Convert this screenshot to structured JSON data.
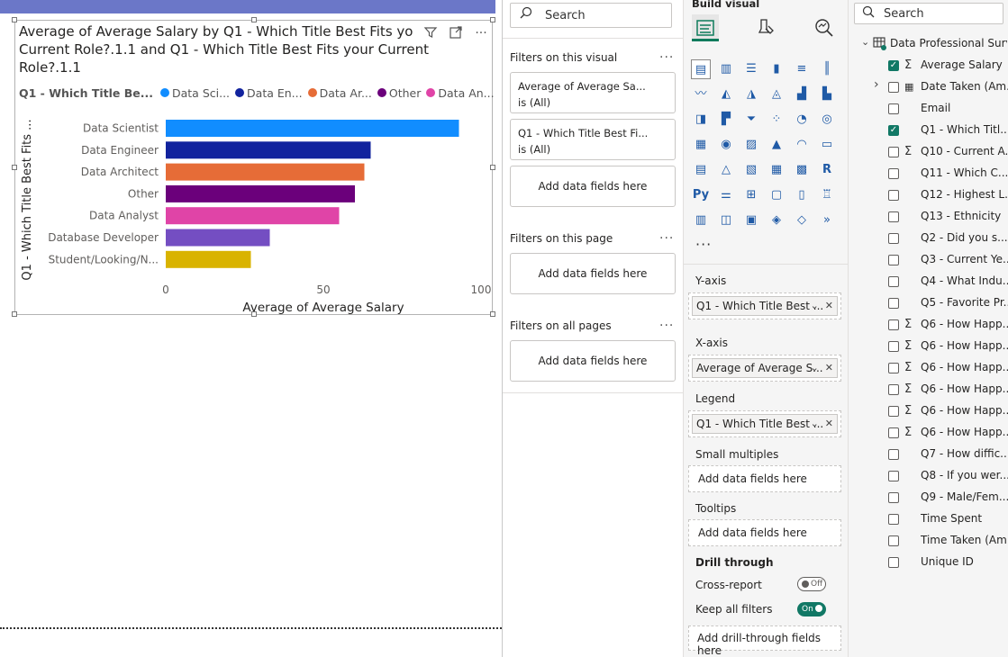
{
  "visual": {
    "title": "Average of Average Salary by Q1 - Which Title Best Fits your Current Role?.1.1 and Q1 - Which Title Best Fits your Current Role?.1.1",
    "title_line1": "Average of Average Salary by Q1 - Which Title Best Fits yo",
    "title_line2": "Current Role?.1.1 and Q1 - Which Title Best Fits your Current",
    "title_line3": "Role?.1.1",
    "legend_title": "Q1 - Which Title Be...",
    "legend_items": [
      {
        "label": "Data Sci...",
        "color": "#118dff"
      },
      {
        "label": "Data En...",
        "color": "#12239e"
      },
      {
        "label": "Data Ar...",
        "color": "#e66c37"
      },
      {
        "label": "Other",
        "color": "#6b007b"
      },
      {
        "label": "Data An...",
        "color": "#e044a7"
      }
    ]
  },
  "chart_data": {
    "type": "bar",
    "orientation": "horizontal",
    "categories": [
      "Data Scientist",
      "Data Engineer",
      "Data Architect",
      "Other",
      "Data Analyst",
      "Database Developer",
      "Student/Looking/N..."
    ],
    "values": [
      93,
      65,
      63,
      60,
      55,
      33,
      27
    ],
    "colors": [
      "#118dff",
      "#12239e",
      "#e66c37",
      "#6b007b",
      "#e044a7",
      "#744ec2",
      "#d9b300"
    ],
    "xlabel": "Average of Average Salary",
    "ylabel": "Q1 - Which Title Best Fits ...",
    "xlim": [
      0,
      100
    ],
    "xticks": [
      "0",
      "50",
      "100"
    ],
    "grid": false,
    "legend_position": "top-left"
  },
  "filters": {
    "search_placeholder": "Search",
    "on_visual_title": "Filters on this visual",
    "card1_line1": "Average of Average Sa...",
    "card1_line2": "is (All)",
    "card2_line1": "Q1 - Which Title Best Fi...",
    "card2_line2": "is (All)",
    "add_fields": "Add data fields here",
    "on_page_title": "Filters on this page",
    "on_all_pages_title": "Filters on all pages",
    "more": "···"
  },
  "build": {
    "title": "Build visual",
    "more": "···",
    "yaxis_label": "Y-axis",
    "yaxis_field": "Q1 - Which Title Best ...",
    "xaxis_label": "X-axis",
    "xaxis_field": "Average of Average S...",
    "legend_label": "Legend",
    "legend_field": "Q1 - Which Title Best ...",
    "small_multiples_label": "Small multiples",
    "tooltips_label": "Tooltips",
    "add_fields": "Add data fields here",
    "drill_through_label": "Drill through",
    "cross_report_label": "Cross-report",
    "cross_report_state": "Off",
    "keep_filters_label": "Keep all filters",
    "keep_filters_state": "On",
    "add_drill_fields": "Add drill-through fields here"
  },
  "data": {
    "search_placeholder": "Search",
    "table_name": "Data Professional Surv...",
    "fields": [
      {
        "label": "Average Salary",
        "checked": true,
        "sigma": true
      },
      {
        "label": "Date Taken (Am...",
        "checked": false,
        "sigma": false,
        "expandable": true
      },
      {
        "label": "Email",
        "checked": false,
        "sigma": false
      },
      {
        "label": "Q1 - Which Titl...",
        "checked": true,
        "sigma": false
      },
      {
        "label": "Q10 - Current A...",
        "checked": false,
        "sigma": true
      },
      {
        "label": "Q11 - Which C...",
        "checked": false,
        "sigma": false
      },
      {
        "label": "Q12 - Highest L...",
        "checked": false,
        "sigma": false
      },
      {
        "label": "Q13 - Ethnicity",
        "checked": false,
        "sigma": false
      },
      {
        "label": "Q2 - Did you s...",
        "checked": false,
        "sigma": false
      },
      {
        "label": "Q3 - Current Ye...",
        "checked": false,
        "sigma": false
      },
      {
        "label": "Q4 - What Indu...",
        "checked": false,
        "sigma": false
      },
      {
        "label": "Q5 - Favorite Pr...",
        "checked": false,
        "sigma": false
      },
      {
        "label": "Q6 - How Happ...",
        "checked": false,
        "sigma": true
      },
      {
        "label": "Q6 - How Happ...",
        "checked": false,
        "sigma": true
      },
      {
        "label": "Q6 - How Happ...",
        "checked": false,
        "sigma": true
      },
      {
        "label": "Q6 - How Happ...",
        "checked": false,
        "sigma": true
      },
      {
        "label": "Q6 - How Happ...",
        "checked": false,
        "sigma": true
      },
      {
        "label": "Q6 - How Happ...",
        "checked": false,
        "sigma": true
      },
      {
        "label": "Q7 - How diffic...",
        "checked": false,
        "sigma": false
      },
      {
        "label": "Q8 - If you wer...",
        "checked": false,
        "sigma": false
      },
      {
        "label": "Q9 - Male/Fem...",
        "checked": false,
        "sigma": false
      },
      {
        "label": "Time Spent",
        "checked": false,
        "sigma": false
      },
      {
        "label": "Time Taken (Am...",
        "checked": false,
        "sigma": false
      },
      {
        "label": "Unique ID",
        "checked": false,
        "sigma": false
      }
    ]
  }
}
